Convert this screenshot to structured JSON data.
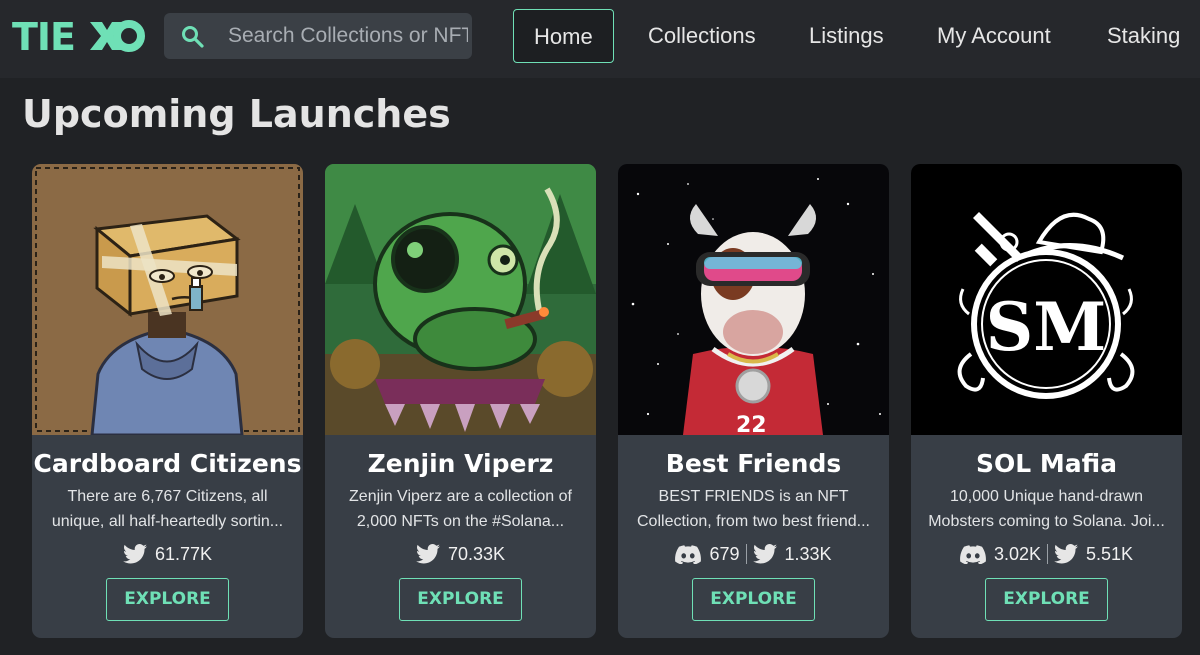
{
  "brand": {
    "logo_text": "TIEXO",
    "accent": "#6fe0b6"
  },
  "search": {
    "placeholder": "Search Collections or NFTs"
  },
  "nav": [
    {
      "label": "Home",
      "active": true
    },
    {
      "label": "Collections"
    },
    {
      "label": "Listings"
    },
    {
      "label": "My Account"
    },
    {
      "label": "Staking"
    }
  ],
  "page": {
    "title": "Upcoming Launches"
  },
  "cards": [
    {
      "name": "Cardboard Citizens",
      "desc_line1": "There are 6,767 Citizens, all",
      "desc_line2": "unique, all half-heartedly sortin...",
      "discord": "",
      "twitter": "61.77K",
      "button": "EXPLORE"
    },
    {
      "name": "Zenjin Viperz",
      "desc_line1": "Zenjin Viperz are a collection of",
      "desc_line2": "2,000 NFTs on the #Solana...",
      "discord": "",
      "twitter": "70.33K",
      "button": "EXPLORE"
    },
    {
      "name": "Best Friends",
      "desc_line1": "BEST FRIENDS is an NFT",
      "desc_line2": "Collection, from two best friend...",
      "discord": "679",
      "twitter": "1.33K",
      "button": "EXPLORE"
    },
    {
      "name": "SOL Mafia",
      "desc_line1": "10,000 Unique hand-drawn",
      "desc_line2": "Mobsters coming to Solana. Joi...",
      "discord": "3.02K",
      "twitter": "5.51K",
      "button": "EXPLORE",
      "logo_text": "SM"
    }
  ]
}
